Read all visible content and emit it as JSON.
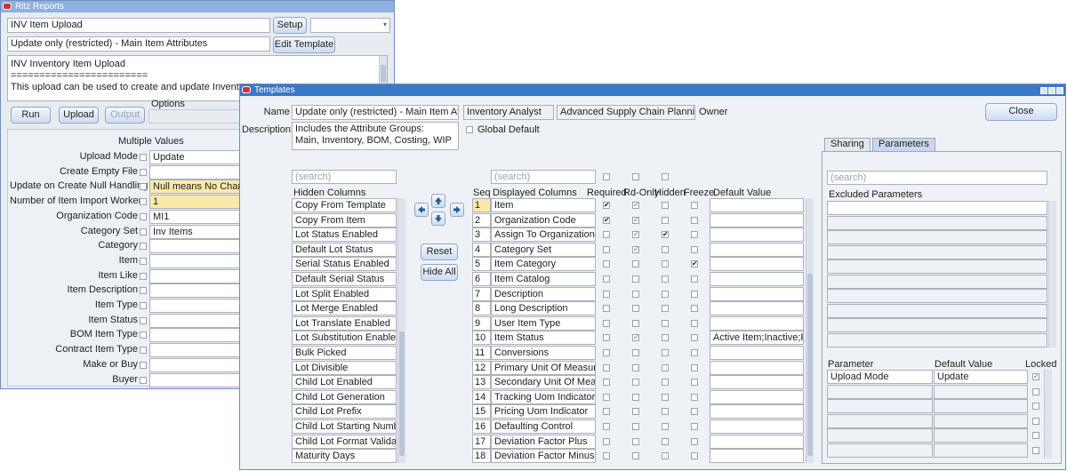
{
  "back_window": {
    "title": "Ritz Reports",
    "report_field": "INV Item Upload",
    "setup_label": "Setup",
    "setup_select": "",
    "template_field": "Update only (restricted) - Main Item Attributes",
    "edit_template_label": "Edit Template",
    "description_lines": [
      "INV Inventory Item Upload",
      "========================",
      "This upload can be used to create and update Inventory Items."
    ],
    "run_label": "Run",
    "upload_label": "Upload",
    "output_label": "Output",
    "options_label": "Options",
    "multiple_values_label": "Multiple Values",
    "params": [
      {
        "label": "Upload Mode",
        "value": "Update"
      },
      {
        "label": "Create Empty File",
        "value": ""
      },
      {
        "label": "Update on Create Null Handling",
        "value": "Null means No Change",
        "hl": true
      },
      {
        "label": "Number of Item Import Workers",
        "value": "1",
        "hl": true
      },
      {
        "label": "Organization Code",
        "value": "MI1"
      },
      {
        "label": "Category Set",
        "value": "Inv Items"
      },
      {
        "label": "Category",
        "value": ""
      },
      {
        "label": "Item",
        "value": ""
      },
      {
        "label": "Item Like",
        "value": ""
      },
      {
        "label": "Item Description",
        "value": ""
      },
      {
        "label": "Item Type",
        "value": ""
      },
      {
        "label": "Item Status",
        "value": ""
      },
      {
        "label": "BOM Item Type",
        "value": ""
      },
      {
        "label": "Contract Item Type",
        "value": ""
      },
      {
        "label": "Make or Buy",
        "value": ""
      },
      {
        "label": "Buyer",
        "value": ""
      }
    ]
  },
  "templates_window": {
    "title": "Templates",
    "name_label": "Name",
    "name_value": "Update only (restricted) - Main Item Attributes",
    "role_value": "Inventory Analyst",
    "app_value": "Advanced Supply Chain Planning",
    "owner_label": "Owner",
    "close_label": "Close",
    "description_label": "Description",
    "description_value": "Includes the Attribute Groups:\nMain, Inventory, BOM, Costing, WIP",
    "global_default_label": "Global Default",
    "search_placeholder": "(search)",
    "hidden_columns_header": "Hidden Columns",
    "hidden_columns": [
      "Copy From Template",
      "Copy From Item",
      "Lot Status Enabled",
      "Default Lot Status",
      "Serial Status Enabled",
      "Default Serial Status",
      "Lot Split Enabled",
      "Lot Merge Enabled",
      "Lot Translate Enabled",
      "Lot Substitution Enabled",
      "Bulk Picked",
      "Lot Divisible",
      "Child Lot Enabled",
      "Child Lot Generation",
      "Child Lot Prefix",
      "Child Lot Starting Number",
      "Child Lot Format Validation",
      "Maturity Days"
    ],
    "reset_label": "Reset",
    "hide_all_label": "Hide All",
    "seq_header": "Seq",
    "displayed_header": "Displayed Columns",
    "required_header": "Required",
    "rdonly_header": "Rd-Only",
    "hidden_header": "Hidden",
    "freeze_header": "Freeze",
    "default_value_header": "Default Value",
    "displayed_rows": [
      {
        "seq": "1",
        "name": "Item",
        "req": "✔",
        "rd": "g✔",
        "hid": "",
        "frz": "",
        "def": ""
      },
      {
        "seq": "2",
        "name": "Organization Code",
        "req": "✔",
        "rd": "g✔",
        "hid": "",
        "frz": "",
        "def": ""
      },
      {
        "seq": "3",
        "name": "Assign To Organizations",
        "req": "",
        "rd": "g✔",
        "hid": "✔",
        "frz": "",
        "def": ""
      },
      {
        "seq": "4",
        "name": "Category Set",
        "req": "",
        "rd": "g✔",
        "hid": "",
        "frz": "",
        "def": ""
      },
      {
        "seq": "5",
        "name": "Item Category",
        "req": "",
        "rd": "",
        "hid": "",
        "frz": "✔",
        "def": ""
      },
      {
        "seq": "6",
        "name": "Item Catalog",
        "req": "",
        "rd": "",
        "hid": "",
        "frz": "",
        "def": ""
      },
      {
        "seq": "7",
        "name": "Description",
        "req": "",
        "rd": "",
        "hid": "",
        "frz": "",
        "def": ""
      },
      {
        "seq": "8",
        "name": "Long Description",
        "req": "",
        "rd": "",
        "hid": "",
        "frz": "",
        "def": ""
      },
      {
        "seq": "9",
        "name": "User Item Type",
        "req": "",
        "rd": "",
        "hid": "",
        "frz": "",
        "def": ""
      },
      {
        "seq": "10",
        "name": "Item Status",
        "req": "",
        "rd": "g✔",
        "hid": "",
        "frz": "",
        "def": "Active Item;Inactive;Protot"
      },
      {
        "seq": "11",
        "name": "Conversions",
        "req": "",
        "rd": "",
        "hid": "",
        "frz": "",
        "def": ""
      },
      {
        "seq": "12",
        "name": "Primary Unit Of Measure",
        "req": "",
        "rd": "",
        "hid": "",
        "frz": "",
        "def": ""
      },
      {
        "seq": "13",
        "name": "Secondary Unit Of Measure",
        "req": "",
        "rd": "",
        "hid": "",
        "frz": "",
        "def": ""
      },
      {
        "seq": "14",
        "name": "Tracking Uom Indicator",
        "req": "",
        "rd": "",
        "hid": "",
        "frz": "",
        "def": ""
      },
      {
        "seq": "15",
        "name": "Pricing Uom Indicator",
        "req": "",
        "rd": "",
        "hid": "",
        "frz": "",
        "def": ""
      },
      {
        "seq": "16",
        "name": "Defaulting Control",
        "req": "",
        "rd": "",
        "hid": "",
        "frz": "",
        "def": ""
      },
      {
        "seq": "17",
        "name": "Deviation Factor Plus",
        "req": "",
        "rd": "",
        "hid": "",
        "frz": "",
        "def": ""
      },
      {
        "seq": "18",
        "name": "Deviation Factor Minus",
        "req": "",
        "rd": "",
        "hid": "",
        "frz": "",
        "def": ""
      }
    ],
    "tabs": [
      "Sharing",
      "Parameters"
    ],
    "active_tab": "Parameters",
    "excluded_parameters_header": "Excluded Parameters",
    "parameter_header": "Parameter",
    "param_default_header": "Default Value",
    "locked_header": "Locked",
    "param_rows": [
      {
        "name": "Upload Mode",
        "value": "Update",
        "locked": "g✔"
      },
      {
        "name": "",
        "value": "",
        "locked": ""
      },
      {
        "name": "",
        "value": "",
        "locked": ""
      },
      {
        "name": "",
        "value": "",
        "locked": ""
      },
      {
        "name": "",
        "value": "",
        "locked": ""
      },
      {
        "name": "",
        "value": "",
        "locked": ""
      }
    ]
  },
  "colors": {
    "titlebar": "#3a78c5",
    "window_bg": "#e8ebf0",
    "highlight_field": "#fbe9a8",
    "button": "#cddcf0"
  }
}
